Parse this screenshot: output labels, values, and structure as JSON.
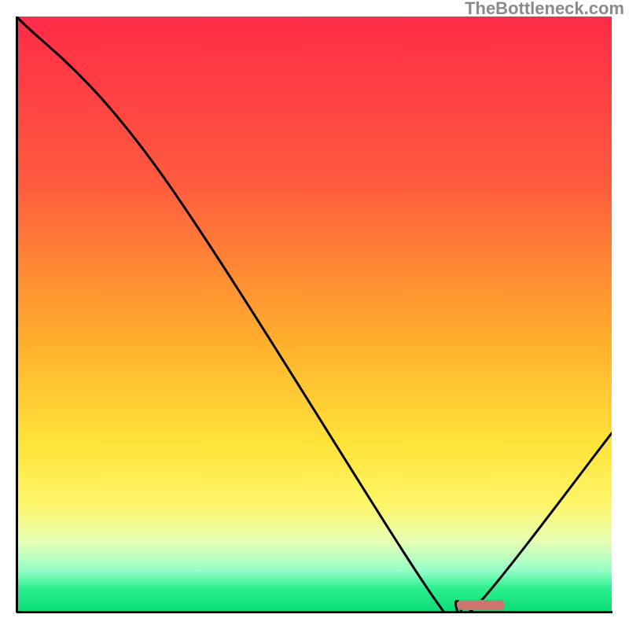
{
  "watermark": "TheBottleneck.com",
  "chart_data": {
    "type": "line",
    "title": "",
    "xlabel": "",
    "ylabel": "",
    "xlim": [
      0,
      100
    ],
    "ylim": [
      0,
      100
    ],
    "grid": false,
    "legend": false,
    "background": "gradient-red-yellow-green",
    "series": [
      {
        "name": "bottleneck-curve",
        "x": [
          0,
          24,
          70,
          74,
          78,
          100
        ],
        "values": [
          100,
          74,
          2.5,
          1.8,
          1.8,
          30
        ]
      }
    ],
    "marker": {
      "name": "optimal-zone",
      "x_start": 74,
      "x_end": 82,
      "y": 1.2,
      "color": "#cf7570"
    }
  }
}
